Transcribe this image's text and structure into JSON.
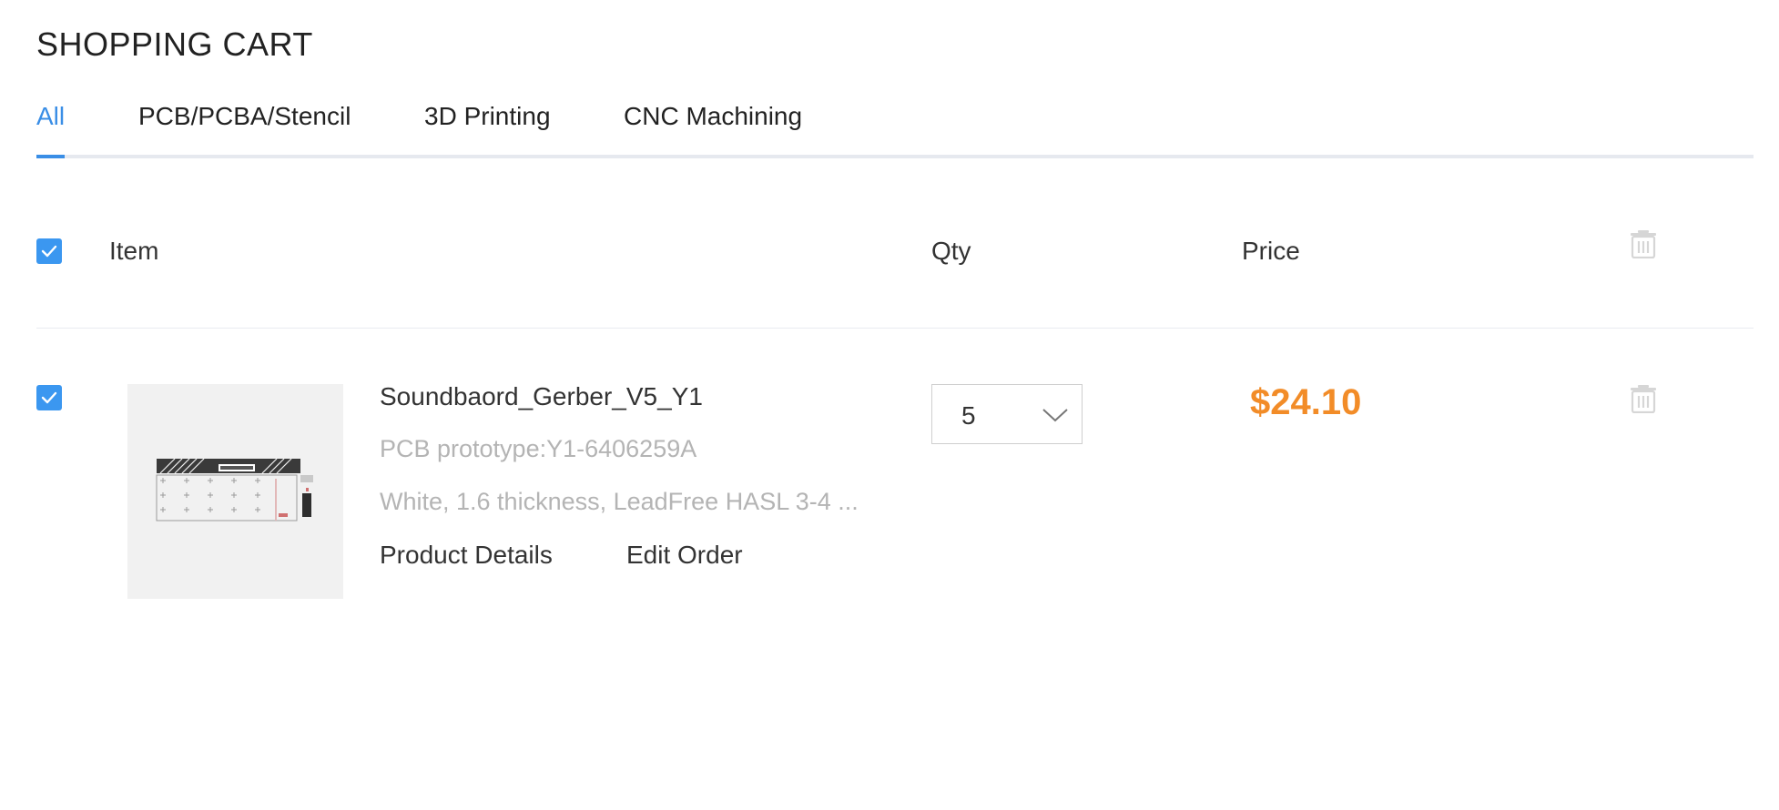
{
  "page": {
    "title": "SHOPPING CART"
  },
  "tabs": [
    {
      "label": "All",
      "active": true
    },
    {
      "label": "PCB/PCBA/Stencil",
      "active": false
    },
    {
      "label": "3D Printing",
      "active": false
    },
    {
      "label": "CNC Machining",
      "active": false
    }
  ],
  "table_header": {
    "select_all_checked": true,
    "item_label": "Item",
    "qty_label": "Qty",
    "price_label": "Price",
    "delete_icon": "trash-icon"
  },
  "cart_items": [
    {
      "checked": true,
      "name": "Soundbaord_Gerber_V5_Y1",
      "subtitle": "PCB prototype:Y1-6406259A",
      "spec": "White, 1.6 thickness, LeadFree HASL 3-4 ...",
      "product_details_label": "Product Details",
      "edit_order_label": "Edit Order",
      "qty": "5",
      "price": "$24.10",
      "delete_icon": "trash-icon"
    }
  ],
  "colors": {
    "accent": "#3a8ee6",
    "checkbox": "#3b97f0",
    "price": "#f28c28",
    "muted_text": "#b4b4b4",
    "icon_gray": "#d6d6d6"
  }
}
